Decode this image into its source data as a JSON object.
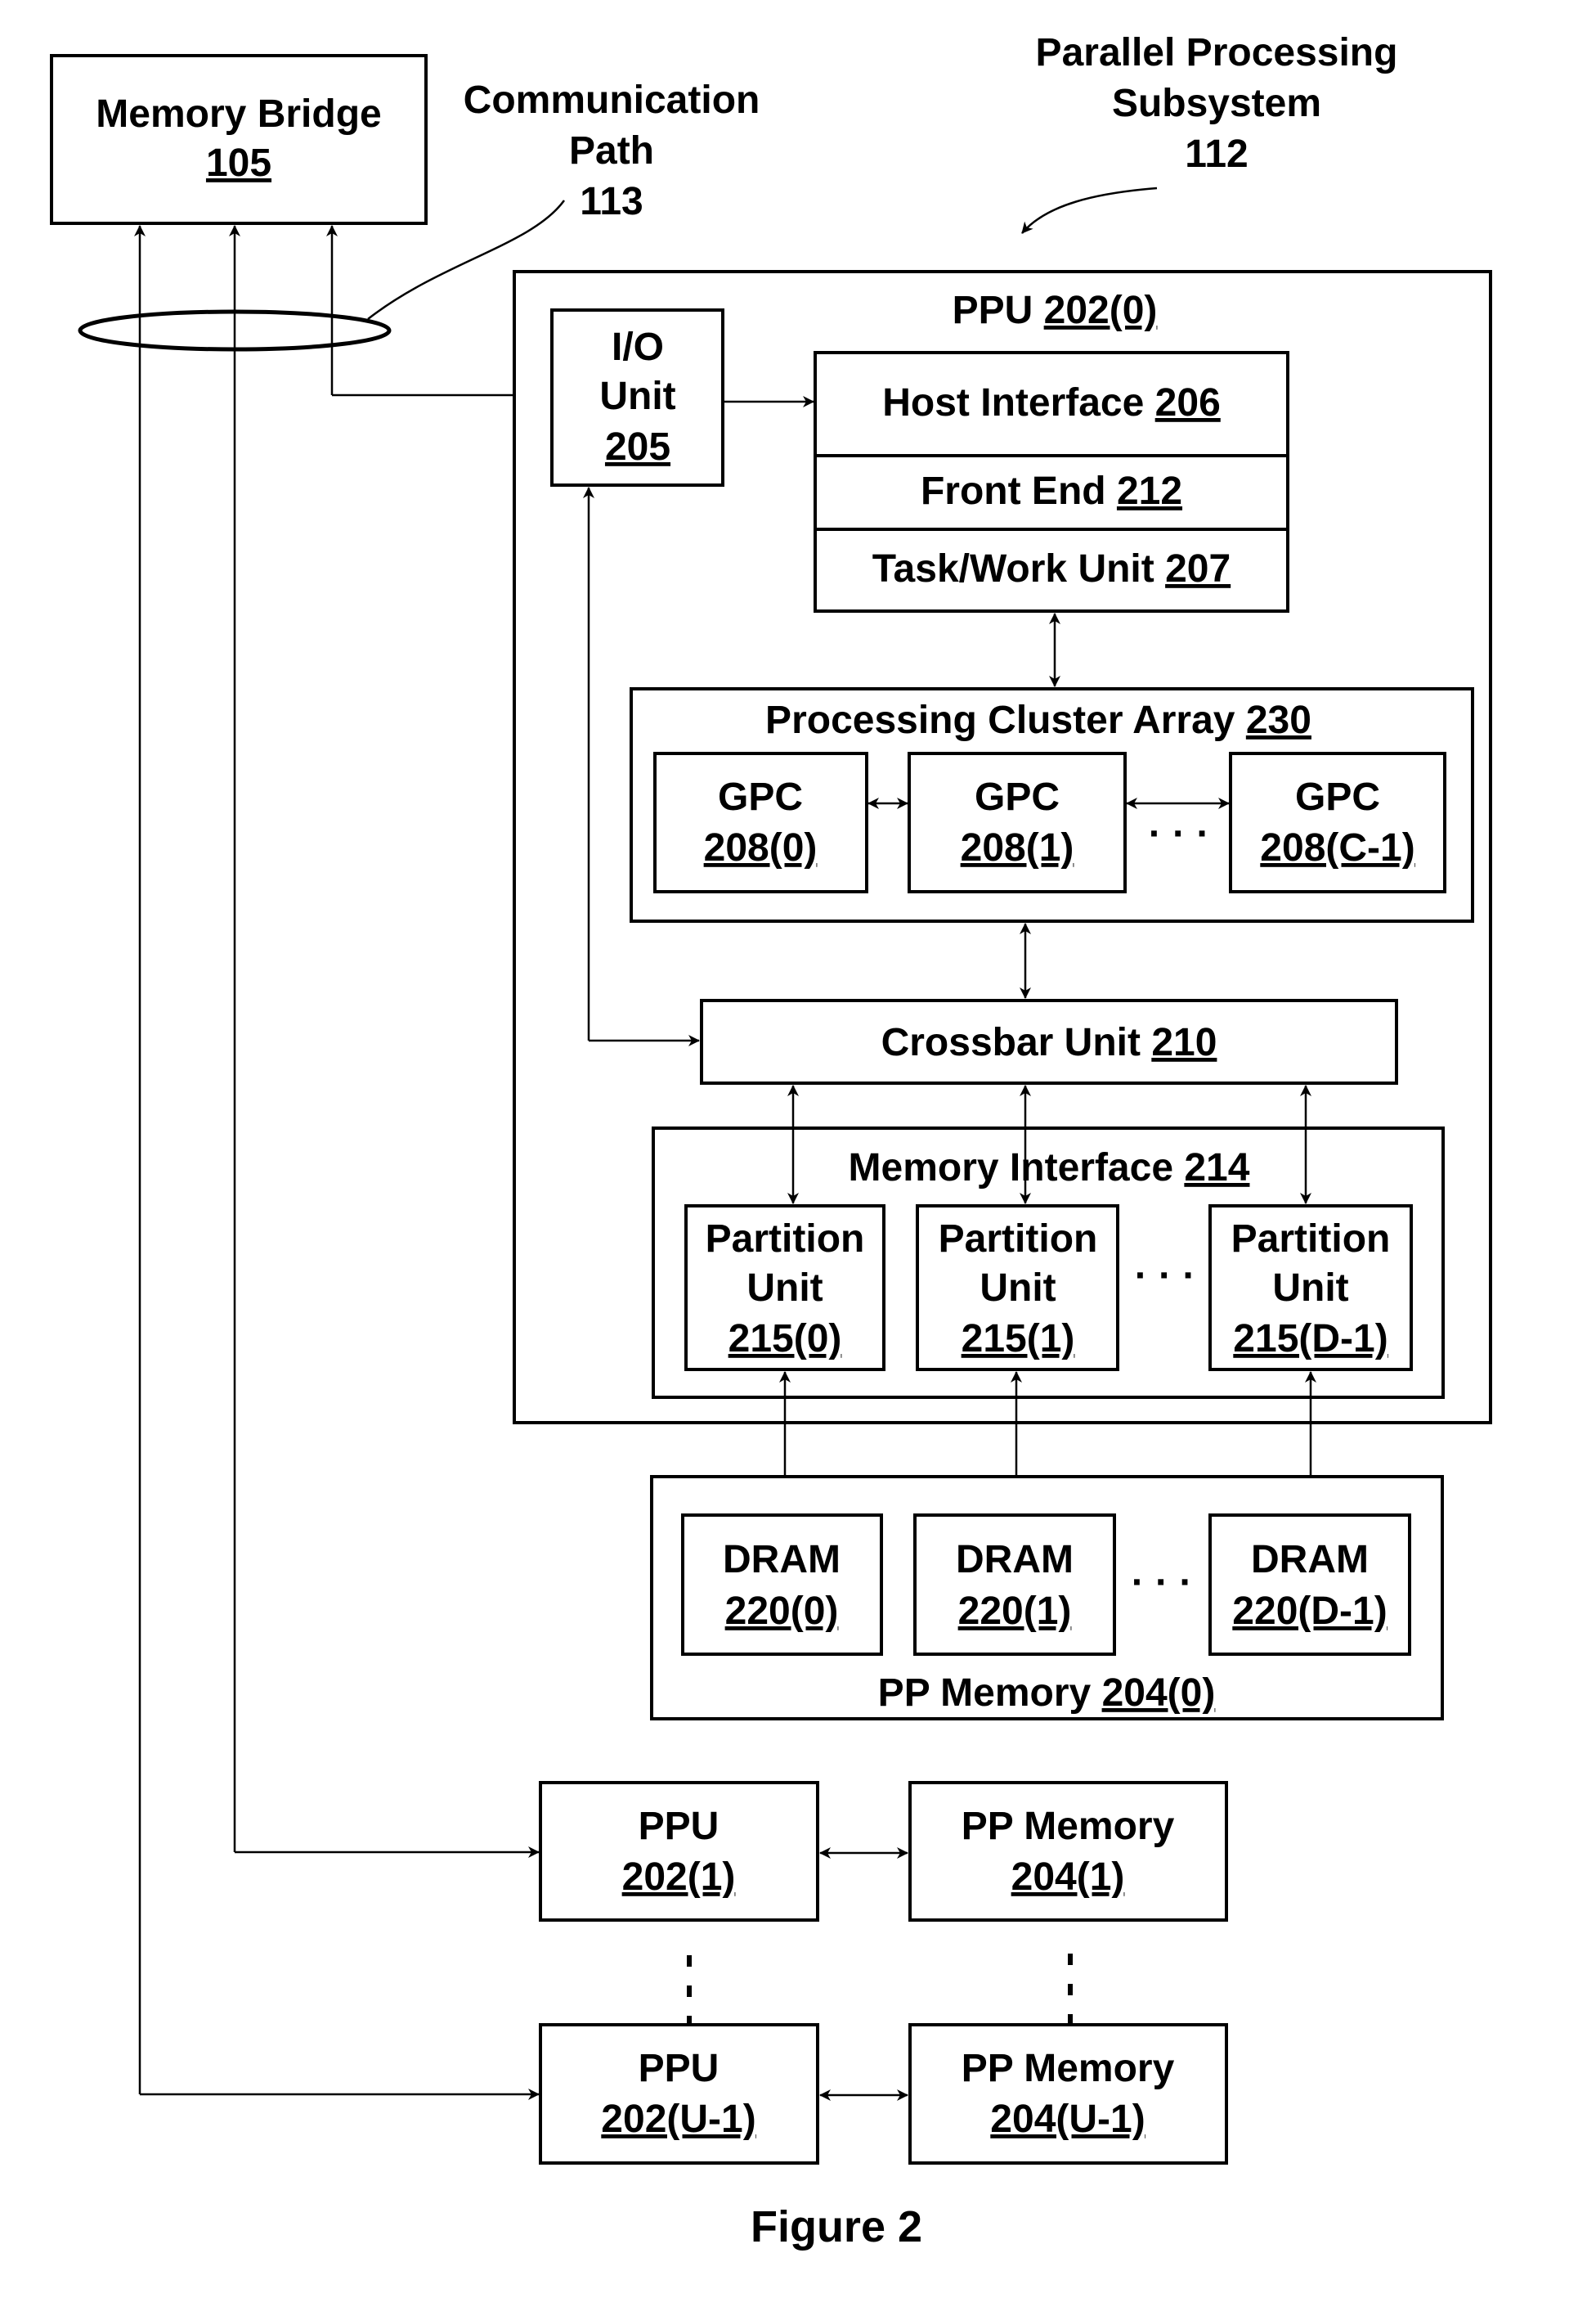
{
  "figure_caption": "Figure 2",
  "labels": {
    "memory_bridge": {
      "name": "Memory Bridge",
      "ref": "105"
    },
    "communication_path": {
      "line1": "Communication",
      "line2": "Path",
      "ref": "113"
    },
    "subsystem": {
      "line1": "Parallel Processing",
      "line2": "Subsystem",
      "ref": "112"
    },
    "ppu0": {
      "name": "PPU",
      "ref": "202(0)"
    },
    "io_unit": {
      "line1": "I/O",
      "line2": "Unit",
      "ref": "205"
    },
    "host_interface": {
      "name": "Host Interface",
      "ref": "206"
    },
    "front_end": {
      "name": "Front End",
      "ref": "212"
    },
    "task_work_unit": {
      "name": "Task/Work Unit",
      "ref": "207"
    },
    "pca": {
      "name": "Processing Cluster Array",
      "ref": "230"
    },
    "gpcs": [
      {
        "name": "GPC",
        "ref": "208(0)"
      },
      {
        "name": "GPC",
        "ref": "208(1)"
      },
      {
        "name": "GPC",
        "ref": "208(C-1)"
      }
    ],
    "crossbar": {
      "name": "Crossbar Unit",
      "ref": "210"
    },
    "memory_interface": {
      "name": "Memory Interface",
      "ref": "214"
    },
    "partitions": [
      {
        "line1": "Partition",
        "line2": "Unit",
        "ref": "215(0)"
      },
      {
        "line1": "Partition",
        "line2": "Unit",
        "ref": "215(1)"
      },
      {
        "line1": "Partition",
        "line2": "Unit",
        "ref": "215(D-1)"
      }
    ],
    "pp_memory0": {
      "name": "PP Memory",
      "ref": "204(0)"
    },
    "drams": [
      {
        "name": "DRAM",
        "ref": "220(0)"
      },
      {
        "name": "DRAM",
        "ref": "220(1)"
      },
      {
        "name": "DRAM",
        "ref": "220(D-1)"
      }
    ],
    "ppu1": {
      "name": "PPU",
      "ref": "202(1)"
    },
    "pp_memory1": {
      "name": "PP Memory",
      "ref": "204(1)"
    },
    "ppu_last": {
      "name": "PPU",
      "ref": "202(U-1)"
    },
    "pp_memory_last": {
      "name": "PP Memory",
      "ref": "204(U-1)"
    },
    "ellipsis_h": "· · ·",
    "ellipsis_v": "·"
  }
}
